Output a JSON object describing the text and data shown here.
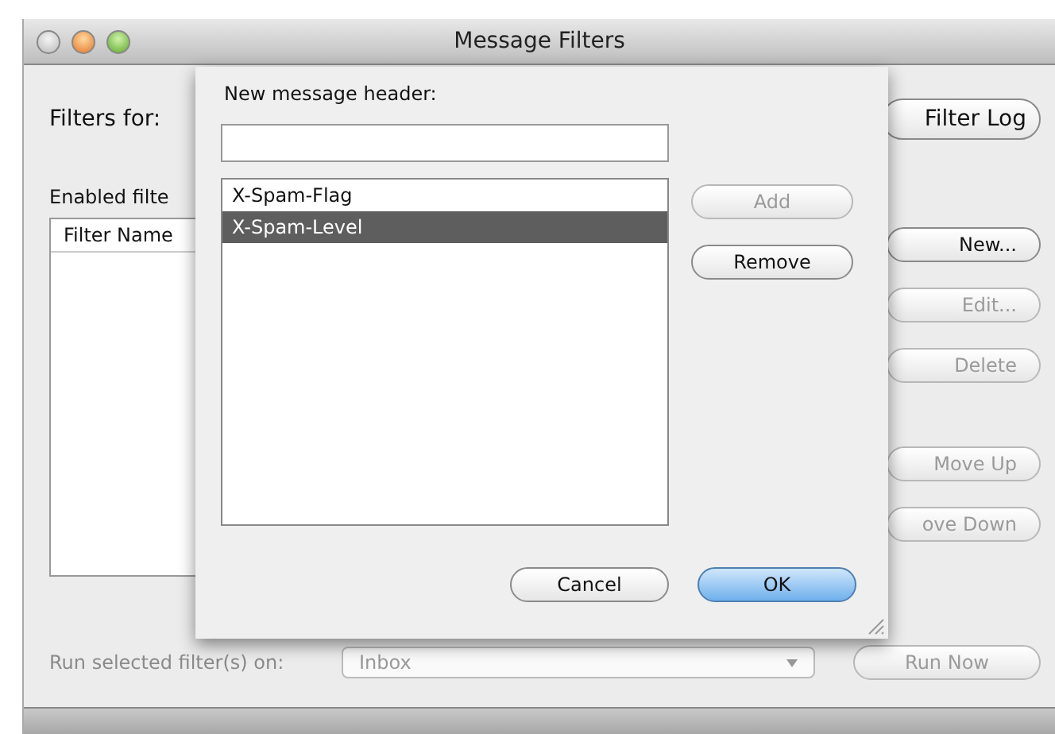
{
  "window": {
    "title": "Message Filters"
  },
  "filters_for": {
    "label": "Filters for:",
    "log_button": "Filter Log"
  },
  "enabled_label": "Enabled filte",
  "table": {
    "columns": [
      "Filter Name"
    ]
  },
  "side_buttons": [
    {
      "label": "New...",
      "disabled": false
    },
    {
      "label": "Edit...",
      "disabled": true
    },
    {
      "label": "Delete",
      "disabled": true
    },
    {
      "label": "Move Up",
      "disabled": true
    },
    {
      "label": "ove Down",
      "disabled": true
    }
  ],
  "run_row": {
    "label": "Run selected filter(s) on:",
    "folder": "Inbox",
    "button": "Run Now",
    "disabled": true
  },
  "sheet": {
    "label": "New message header:",
    "headers": [
      {
        "name": "X-Spam-Flag",
        "selected": false
      },
      {
        "name": "X-Spam-Level",
        "selected": true
      }
    ],
    "side_buttons": [
      {
        "label": "Add",
        "disabled": true
      },
      {
        "label": "Remove",
        "disabled": false
      }
    ],
    "footer_buttons": [
      {
        "label": "Cancel",
        "default": false
      },
      {
        "label": "OK",
        "default": true
      }
    ]
  }
}
